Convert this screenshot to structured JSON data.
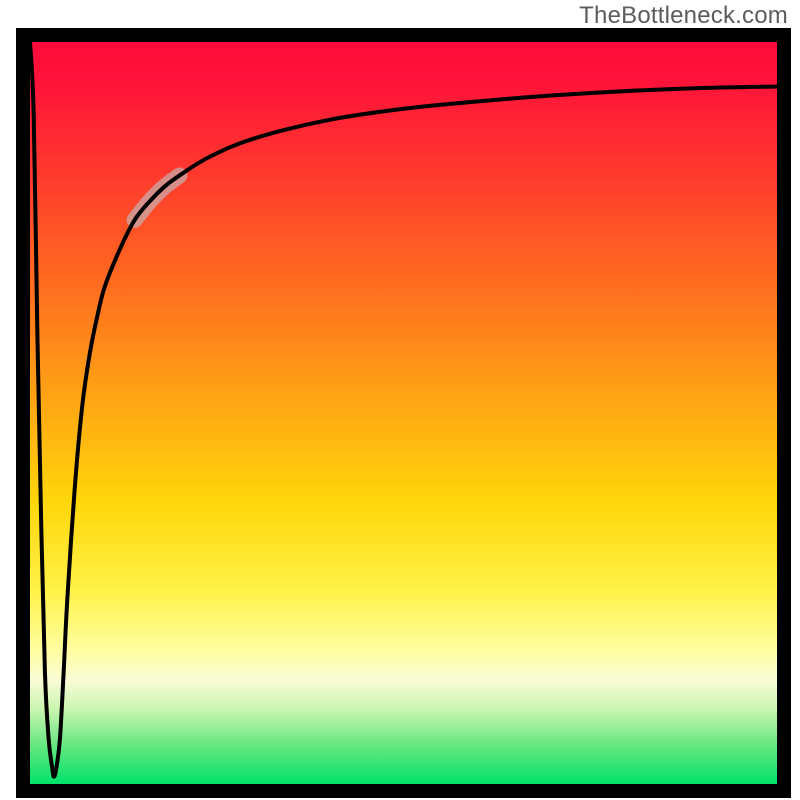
{
  "watermark": "TheBottleneck.com",
  "chart_data": {
    "type": "line",
    "title": "",
    "xlabel": "",
    "ylabel": "",
    "xlim": [
      0,
      100
    ],
    "ylim": [
      0,
      100
    ],
    "x": [
      0,
      0.5,
      1.0,
      1.5,
      2.0,
      2.5,
      3.0,
      3.2,
      3.5,
      4.0,
      4.5,
      5,
      6,
      7,
      8,
      9,
      10,
      12,
      14,
      16,
      18,
      20,
      24,
      30,
      40,
      50,
      60,
      70,
      80,
      90,
      100
    ],
    "values": [
      100,
      90,
      60,
      35,
      15,
      6,
      2,
      1,
      2,
      6,
      15,
      25,
      40,
      51,
      58,
      63,
      67,
      72,
      76,
      78.5,
      80.5,
      82,
      84.5,
      87,
      89.5,
      91,
      92,
      92.8,
      93.4,
      93.8,
      94
    ],
    "highlight_band_y": [
      76,
      82
    ],
    "gradient_stops": [
      {
        "pos": 0.0,
        "color": "#ff0a3b"
      },
      {
        "pos": 0.18,
        "color": "#ff3a2d"
      },
      {
        "pos": 0.48,
        "color": "#ffa414"
      },
      {
        "pos": 0.74,
        "color": "#fff24a"
      },
      {
        "pos": 0.9,
        "color": "#c8f5af"
      },
      {
        "pos": 1.0,
        "color": "#00e36a"
      }
    ]
  }
}
